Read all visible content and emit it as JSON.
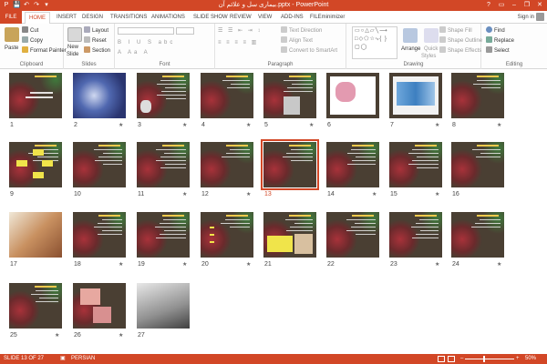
{
  "titlebar": {
    "title": "بیماری سل و علائم آن.pptx - PowerPoint",
    "qat": [
      "P",
      "💾",
      "↶",
      "↷",
      "▾"
    ],
    "controls": [
      "?",
      "▭",
      "–",
      "❐",
      "✕"
    ]
  },
  "tabs": {
    "file": "FILE",
    "items": [
      "HOME",
      "INSERT",
      "DESIGN",
      "TRANSITIONS",
      "ANIMATIONS",
      "SLIDE SHOW",
      "REVIEW",
      "VIEW",
      "ADD-INS",
      "FILEminimizer"
    ],
    "signin": "Sign in"
  },
  "ribbon": {
    "clipboard": {
      "label": "Clipboard",
      "paste": "Paste",
      "cut": "Cut",
      "copy": "Copy",
      "format_painter": "Format Painter"
    },
    "slides": {
      "label": "Slides",
      "new_slide": "New",
      "new_slide2": "Slide",
      "layout": "Layout",
      "reset": "Reset",
      "section": "Section"
    },
    "font": {
      "label": "Font"
    },
    "paragraph": {
      "label": "Paragraph",
      "text_direction": "Text Direction",
      "align_text": "Align Text",
      "convert_smartart": "Convert to SmartArt"
    },
    "drawing": {
      "label": "Drawing",
      "arrange": "Arrange",
      "quick_styles": "Quick",
      "quick_styles2": "Styles",
      "shape_fill": "Shape Fill",
      "shape_outline": "Shape Outline",
      "shape_effects": "Shape Effects",
      "shapes_glyphs": "▭○△▱╲⟶ □◇⬠☆⤷{ } ▢◯"
    },
    "editing": {
      "label": "Editing",
      "find": "Find",
      "replace": "Replace",
      "select": "Select"
    }
  },
  "slides": [
    {
      "num": "1",
      "star": false
    },
    {
      "num": "2",
      "star": true
    },
    {
      "num": "3",
      "star": true
    },
    {
      "num": "4",
      "star": true
    },
    {
      "num": "5",
      "star": true
    },
    {
      "num": "6",
      "star": false
    },
    {
      "num": "7",
      "star": true
    },
    {
      "num": "8",
      "star": true
    },
    {
      "num": "9",
      "star": false
    },
    {
      "num": "10",
      "star": false
    },
    {
      "num": "11",
      "star": true
    },
    {
      "num": "12",
      "star": true
    },
    {
      "num": "13",
      "star": false
    },
    {
      "num": "14",
      "star": true
    },
    {
      "num": "15",
      "star": true
    },
    {
      "num": "16",
      "star": false
    },
    {
      "num": "17",
      "star": false
    },
    {
      "num": "18",
      "star": true
    },
    {
      "num": "19",
      "star": true
    },
    {
      "num": "20",
      "star": true
    },
    {
      "num": "21",
      "star": false
    },
    {
      "num": "22",
      "star": false
    },
    {
      "num": "23",
      "star": true
    },
    {
      "num": "24",
      "star": true
    },
    {
      "num": "25",
      "star": true
    },
    {
      "num": "26",
      "star": true
    },
    {
      "num": "27",
      "star": false
    }
  ],
  "selected_slide": "13",
  "status": {
    "slide_info": "SLIDE 13 OF 27",
    "language": "PERSIAN",
    "zoom": "50%",
    "zoom_minus": "–",
    "zoom_plus": "+"
  },
  "colors": {
    "accent": "#d24726",
    "slide_bg": "#4a3f33"
  }
}
